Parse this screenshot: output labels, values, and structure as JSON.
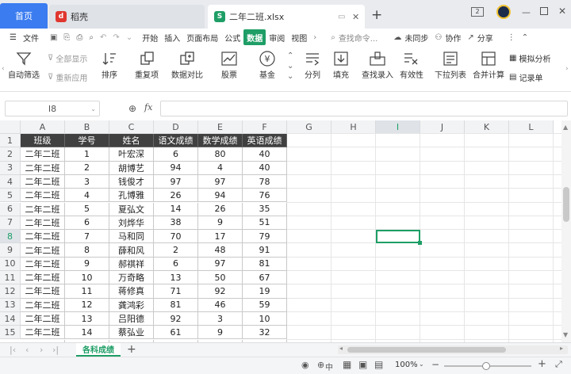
{
  "tabs": {
    "home": "首页",
    "docer": "稻壳",
    "file": "二年二班.xlsx"
  },
  "window": {
    "badge": "2"
  },
  "menubar": {
    "file_menu": "文件",
    "items": [
      "开始",
      "插入",
      "页面布局",
      "公式",
      "数据",
      "审阅",
      "视图"
    ],
    "active_index": 4,
    "search": "查找命令...",
    "sync": "未同步",
    "collab": "协作",
    "share": "分享"
  },
  "ribbon": {
    "auto_filter": "自动筛选",
    "show_all": "全部显示",
    "reapply": "重新应用",
    "sort": "排序",
    "duplicates": "重复项",
    "compare": "数据对比",
    "stock": "股票",
    "fund": "基金",
    "split": "分列",
    "fill": "填充",
    "lookup": "查找录入",
    "validity": "有效性",
    "dropdown": "下拉列表",
    "consolidate": "合并计算",
    "simulate": "模拟分析",
    "record": "记录单"
  },
  "formula": {
    "cell_ref": "I8",
    "fx": "fx"
  },
  "columns": [
    "A",
    "B",
    "C",
    "D",
    "E",
    "F",
    "G",
    "H",
    "I",
    "J",
    "K",
    "L"
  ],
  "table": {
    "headers": [
      "班级",
      "学号",
      "姓名",
      "语文成绩",
      "数学成绩",
      "英语成绩"
    ],
    "rows": [
      [
        "二年二班",
        "1",
        "叶宏深",
        "6",
        "80",
        "40"
      ],
      [
        "二年二班",
        "2",
        "胡博艺",
        "94",
        "4",
        "40"
      ],
      [
        "二年二班",
        "3",
        "钱俊才",
        "97",
        "97",
        "78"
      ],
      [
        "二年二班",
        "4",
        "孔博雅",
        "26",
        "94",
        "76"
      ],
      [
        "二年二班",
        "5",
        "夏弘文",
        "14",
        "26",
        "35"
      ],
      [
        "二年二班",
        "6",
        "刘烨华",
        "38",
        "9",
        "51"
      ],
      [
        "二年二班",
        "7",
        "马和同",
        "70",
        "17",
        "79"
      ],
      [
        "二年二班",
        "8",
        "薛和风",
        "2",
        "48",
        "91"
      ],
      [
        "二年二班",
        "9",
        "郝祺祥",
        "6",
        "97",
        "81"
      ],
      [
        "二年二班",
        "10",
        "万奇略",
        "13",
        "50",
        "67"
      ],
      [
        "二年二班",
        "11",
        "蒋修真",
        "71",
        "92",
        "19"
      ],
      [
        "二年二班",
        "12",
        "龚鸿彩",
        "81",
        "46",
        "59"
      ],
      [
        "二年二班",
        "13",
        "吕阳德",
        "92",
        "3",
        "10"
      ],
      [
        "二年二班",
        "14",
        "蔡弘业",
        "61",
        "9",
        "32"
      ]
    ]
  },
  "row_numbers": [
    "1",
    "2",
    "3",
    "4",
    "5",
    "6",
    "7",
    "8",
    "9",
    "10",
    "11",
    "12",
    "13",
    "14",
    "15"
  ],
  "sheet": {
    "name": "各科成绩",
    "add": "+"
  },
  "status": {
    "zoom": "100%"
  },
  "colors": {
    "accent": "#1e9e66",
    "header_bg": "#404040",
    "home_tab": "#3b7cf0"
  }
}
